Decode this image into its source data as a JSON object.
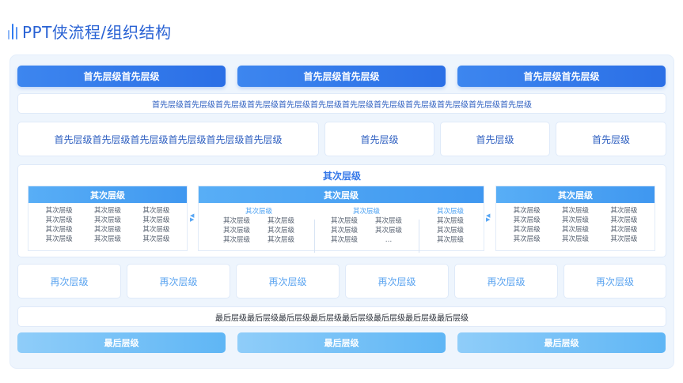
{
  "title": "PPT侠流程/组织结构",
  "level1": {
    "headers": [
      "首先层级首先层级",
      "首先层级首先层级",
      "首先层级首先层级"
    ],
    "strip": "首先层级首先层级首先层级首先层级首先层级首先层级首先层级首先层级首先层级首先层级首先层级首先层级",
    "cards": [
      "首先层级首先层级首先层级首先层级首先层级首先层级",
      "首先层级",
      "首先层级",
      "首先层级"
    ]
  },
  "level2": {
    "title": "其次层级",
    "left": {
      "head": "其次层级",
      "cells": [
        "其次层级",
        "其次层级",
        "其次层级",
        "其次层级",
        "其次层级",
        "其次层级",
        "其次层级",
        "其次层级",
        "其次层级",
        "其次层级",
        "其次层级",
        "其次层级"
      ]
    },
    "middle": {
      "head": "其次层级",
      "col1_head": "其次层级",
      "col1": [
        "其次层级",
        "其次层级",
        "其次层级",
        "其次层级",
        "其次层级",
        "其次层级"
      ],
      "col2_head": "其次层级",
      "col2": [
        "其次层级",
        "其次层级",
        "其次层级",
        "其次层级",
        "其次层级",
        "…"
      ],
      "col3_head": "其次层级",
      "col3": [
        "其次层级",
        "其次层级",
        "其次层级"
      ]
    },
    "right": {
      "head": "其次层级",
      "cells": [
        "其次层级",
        "其次层级",
        "其次层级",
        "其次层级",
        "其次层级",
        "其次层级",
        "其次层级",
        "其次层级",
        "其次层级",
        "其次层级",
        "其次层级",
        "其次层级"
      ]
    }
  },
  "level3": {
    "cards": [
      "再次层级",
      "再次层级",
      "再次层级",
      "再次层级",
      "再次层级",
      "再次层级"
    ]
  },
  "level4": {
    "strip": "最后层级最后层级最后层级最后层级最后层级最后层级最后层级最后层级",
    "footers": [
      "最后层级",
      "最后层级",
      "最后层级"
    ]
  }
}
